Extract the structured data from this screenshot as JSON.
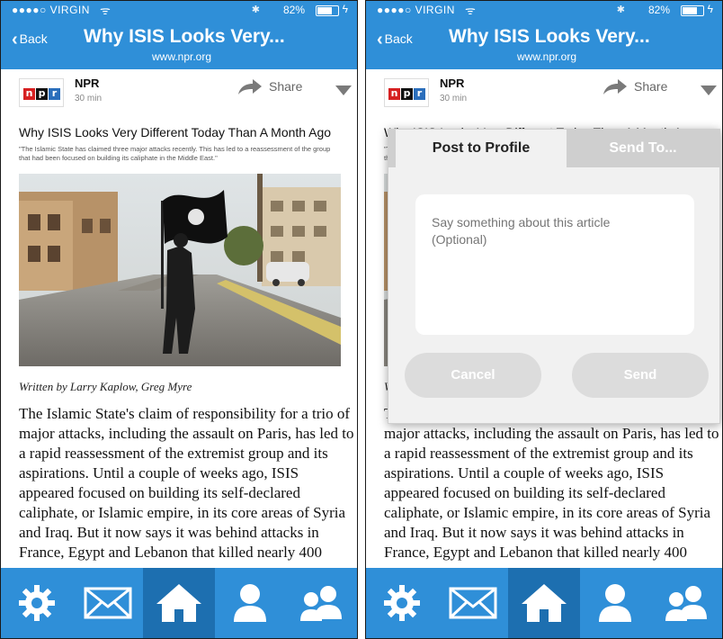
{
  "status": {
    "carrier": "●●●●○ VIRGIN",
    "wifi": "ᯤ",
    "bluetooth": "✱",
    "battery": "82%",
    "battery_level": 0.82
  },
  "nav": {
    "back": "Back",
    "title": "Why ISIS Looks Very...",
    "url": "www.npr.org"
  },
  "source": {
    "logo_letters": [
      "n",
      "p",
      "r"
    ],
    "logo_colors": [
      "#d62021",
      "#111111",
      "#2a6ebb"
    ],
    "name": "NPR",
    "time": "30 min"
  },
  "share_label": "Share",
  "article": {
    "headline": "Why ISIS Looks Very Different Today Than A Month Ago",
    "excerpt": "\"The Islamic State has claimed three major attacks recently. This has led to a reassessment of the group that had been focused on building its caliphate in the Middle East.\"",
    "byline": "Written by Larry Kaplow, Greg Myre",
    "body": "The Islamic State's claim of responsibility for a trio of major attacks, including the assault on Paris, has led to a rapid reassessment of the extremist group and its aspirations. Until a couple of weeks ago, ISIS appeared focused on building its self-declared caliphate, or Islamic empire, in its core areas of Syria and Iraq. But it now says it was behind attacks in France, Egypt and Lebanon that killed nearly 400"
  },
  "modal": {
    "tab_post": "Post to Profile",
    "tab_send": "Send To...",
    "placeholder": "Say something about this article\n(Optional)",
    "cancel": "Cancel",
    "send": "Send"
  },
  "tabbar": [
    {
      "icon": "gear-icon",
      "active": false
    },
    {
      "icon": "mail-icon",
      "active": false
    },
    {
      "icon": "home-icon",
      "active": true
    },
    {
      "icon": "person-icon",
      "active": false
    },
    {
      "icon": "people-icon",
      "active": false
    }
  ],
  "colors": {
    "accent": "#2f8fd8",
    "tab_active": "#1d6fb0"
  }
}
